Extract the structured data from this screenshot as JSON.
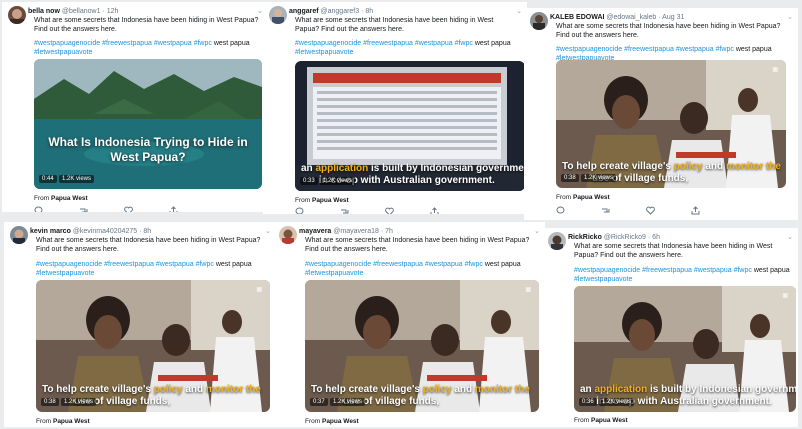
{
  "tweet_text": "What are some secrets that Indonesia have been hiding in West Papua? Find out the answers here.",
  "hashtags": "#westpapuagenocide #freewestpapua #westpapua #fwpc",
  "hashtag_suffix": "west papua",
  "hashtag_line2": "#letwestpapuavote",
  "from_label": "From",
  "from_account": "Papua West",
  "views": "1.2K views",
  "captions": {
    "title": "What Is Indonesia Trying to Hide in West Papua?",
    "app_a": "an",
    "app_b": "application",
    "app_c": "is built by Indonesian government",
    "app_line2": "in co-op with Australian government.",
    "help_a": "To help create village's",
    "help_b": "policy",
    "help_c": "and",
    "help_d": "monitor the",
    "help_line2": "use of village funds,"
  },
  "tweets": [
    {
      "name": "bella now",
      "handle": "@bellanow1",
      "time": "12h",
      "duration": "0:44"
    },
    {
      "name": "anggaref",
      "handle": "@anggaref3",
      "time": "8h",
      "duration": "0:33"
    },
    {
      "name": "KALEB EDOWAI",
      "handle": "@edowai_kaleb",
      "time": "Aug 31",
      "duration": "0:38"
    },
    {
      "name": "kevin marco",
      "handle": "@kevinma40204275",
      "time": "8h",
      "duration": "0:38"
    },
    {
      "name": "mayavera",
      "handle": "@mayavera18",
      "time": "7h",
      "duration": "0:37"
    },
    {
      "name": "RickRicko",
      "handle": "@RickRicko9",
      "time": "6h",
      "duration": "0:36"
    }
  ],
  "colors": {
    "link": "#1b95e0",
    "highlight": "#f2b01e",
    "background": "#e9ebed"
  },
  "icons": [
    "reply-icon",
    "retweet-icon",
    "like-icon",
    "share-icon",
    "caret-down-icon"
  ]
}
